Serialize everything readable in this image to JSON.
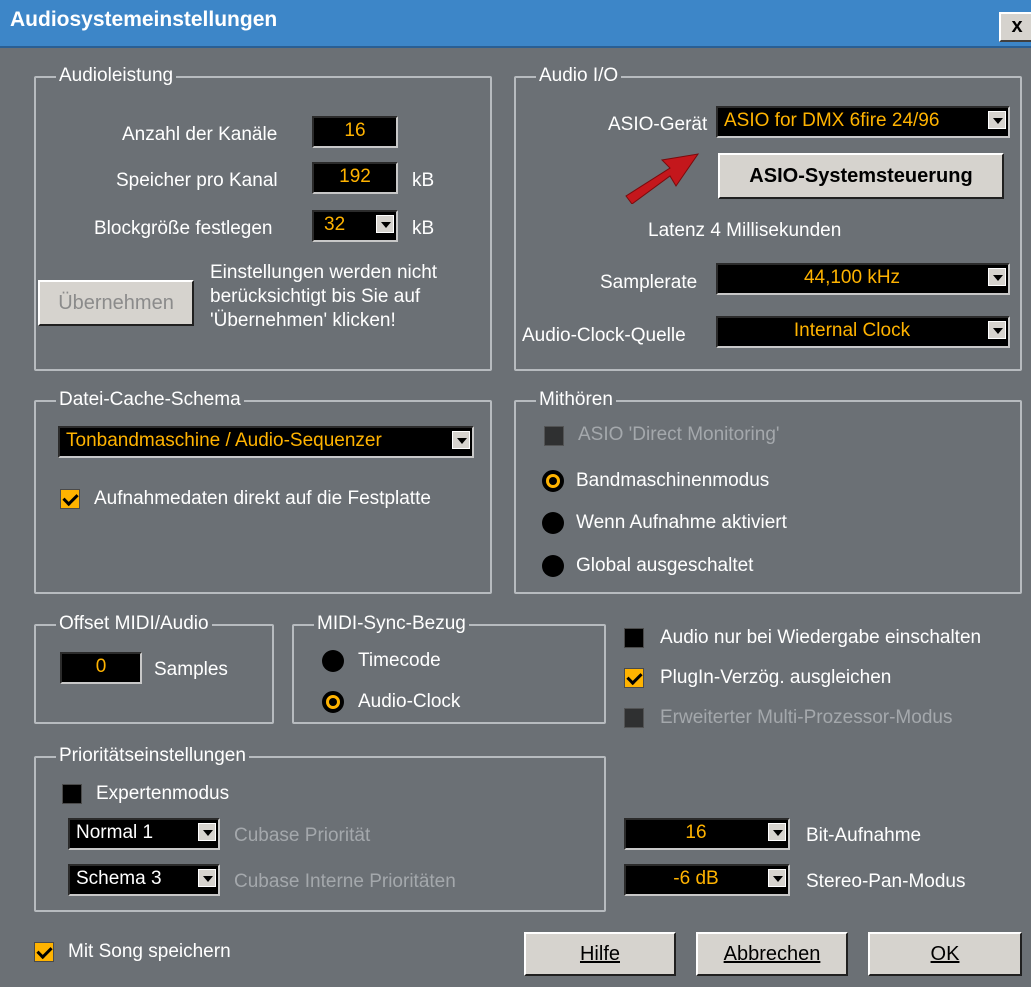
{
  "window": {
    "title": "Audiosystemeinstellungen",
    "close_label": "x"
  },
  "audioleistung": {
    "legend": "Audioleistung",
    "channels_label": "Anzahl der Kanäle",
    "channels_value": "16",
    "memory_label": "Speicher pro Kanal",
    "memory_value": "192",
    "memory_unit": "kB",
    "block_label": "Blockgröße festlegen",
    "block_value": "32",
    "block_unit": "kB",
    "apply_button": "Übernehmen",
    "note_line1": "Einstellungen werden nicht",
    "note_line2": "berücksichtigt bis Sie auf",
    "note_line3": "'Übernehmen' klicken!"
  },
  "audio_io": {
    "legend": "Audio I/O",
    "device_label": "ASIO-Gerät",
    "device_value": "ASIO for DMX 6fire 24/96",
    "control_button": "ASIO-Systemsteuerung",
    "latency": "Latenz 4 Millisekunden",
    "samplerate_label": "Samplerate",
    "samplerate_value": "44,100 kHz",
    "clock_label": "Audio-Clock-Quelle",
    "clock_value": "Internal Clock"
  },
  "cache": {
    "legend": "Datei-Cache-Schema",
    "mode_value": "Tonbandmaschine / Audio-Sequenzer",
    "direct_label": "Aufnahmedaten direkt auf die Festplatte",
    "direct_checked": true
  },
  "monitoring": {
    "legend": "Mithören",
    "asio_direct": "ASIO 'Direct Monitoring'",
    "options": [
      "Bandmaschinenmodus",
      "Wenn Aufnahme aktiviert",
      "Global ausgeschaltet"
    ],
    "selected": "Bandmaschinenmodus"
  },
  "offset": {
    "legend": "Offset MIDI/Audio",
    "value": "0",
    "unit": "Samples"
  },
  "midisync": {
    "legend": "MIDI-Sync-Bezug",
    "options": [
      "Timecode",
      "Audio-Clock"
    ],
    "selected": "Audio-Clock"
  },
  "options": {
    "playback_only": "Audio nur bei Wiedergabe einschalten",
    "plugin_delay": "PlugIn-Verzög. ausgleichen",
    "multiprocessor": "Erweiterter Multi-Prozessor-Modus"
  },
  "priority": {
    "legend": "Prioritätseinstellungen",
    "expert": "Expertenmodus",
    "cubase_priority_value": "Normal 1",
    "cubase_priority_label": "Cubase Priorität",
    "internal_value": "Schema 3",
    "internal_label": "Cubase Interne Prioritäten"
  },
  "recording": {
    "bit_value": "16",
    "bit_label": "Bit-Aufnahme",
    "pan_value": "-6 dB",
    "pan_label": "Stereo-Pan-Modus"
  },
  "footer": {
    "save_with_song": "Mit Song speichern",
    "help": "Hilfe",
    "cancel": "Abbrechen",
    "ok": "OK"
  },
  "colors": {
    "background": "#6b7075",
    "title_bar": "#3d86c8",
    "accent": "#ffb300",
    "arrow": "#c4171c"
  }
}
